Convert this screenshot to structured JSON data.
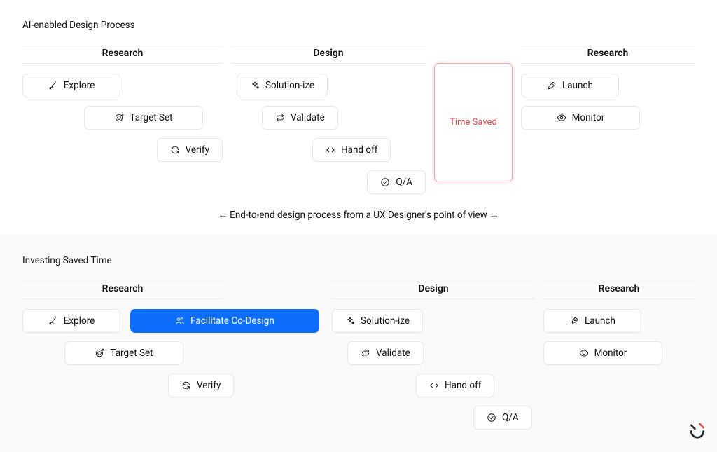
{
  "top": {
    "title": "AI-enabled Design Process",
    "caption": "← End-to-end design process from a UX Designer's point of view →",
    "lanes": {
      "research1": {
        "header": "Research",
        "explore": "Explore",
        "target_set": "Target Set",
        "verify": "Verify"
      },
      "design": {
        "header": "Design",
        "solutionize": "Solution-ize",
        "validate": "Validate",
        "handoff": "Hand off",
        "qa": "Q/A"
      },
      "time_saved": "Time Saved",
      "research2": {
        "header": "Research",
        "launch": "Launch",
        "monitor": "Monitor"
      }
    }
  },
  "bottom": {
    "title": "Investing Saved Time",
    "lanes": {
      "research1": {
        "header": "Research",
        "explore": "Explore",
        "facilitate": "Facilitate Co-Design",
        "target_set": "Target Set",
        "verify": "Verify"
      },
      "design": {
        "header": "Design",
        "solutionize": "Solution-ize",
        "validate": "Validate",
        "handoff": "Hand off",
        "qa": "Q/A"
      },
      "research2": {
        "header": "Research",
        "launch": "Launch",
        "monitor": "Monitor"
      }
    }
  }
}
